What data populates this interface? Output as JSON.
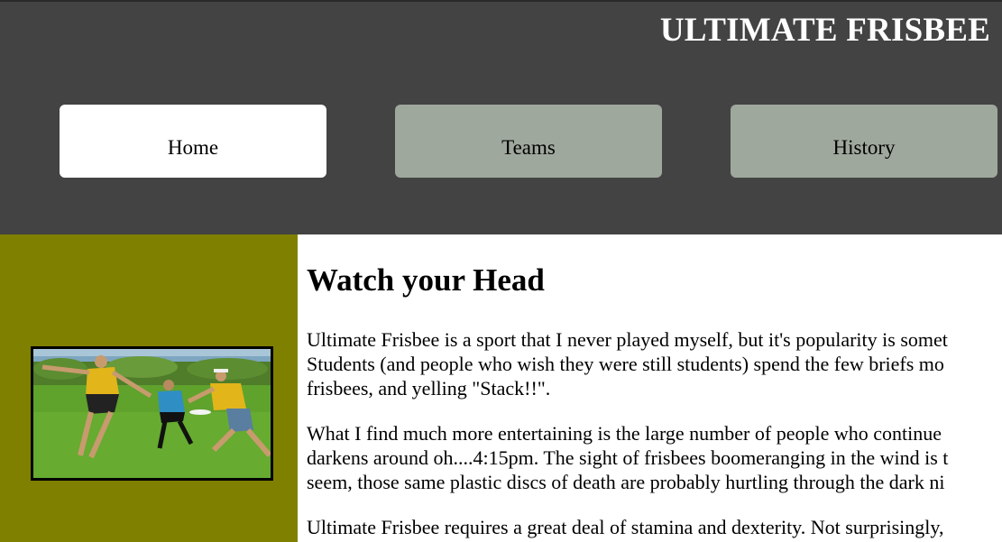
{
  "header": {
    "site_title": "ULTIMATE FRISBEE"
  },
  "nav": {
    "items": [
      {
        "label": "Home",
        "active": true
      },
      {
        "label": "Teams",
        "active": false
      },
      {
        "label": "History",
        "active": false
      }
    ]
  },
  "sidebar": {
    "image_alt": "Ultimate frisbee players on a field"
  },
  "main": {
    "heading": "Watch your Head",
    "paragraphs": [
      {
        "lines": [
          "Ultimate Frisbee is a sport that I never played myself, but it's popularity is somet",
          "Students (and people who wish they were still students) spend the few briefs mo",
          "frisbees, and yelling \"Stack!!\"."
        ]
      },
      {
        "lines": [
          "What I find much more entertaining is the large number of people who continue",
          "darkens around oh....4:15pm. The sight of frisbees boomeranging in the wind is t",
          "seem, those same plastic discs of death are probably hurtling through the dark ni"
        ]
      },
      {
        "lines": [
          "Ultimate Frisbee requires a great deal of stamina and dexterity. Not surprisingly,"
        ]
      }
    ]
  },
  "colors": {
    "header_bg": "#434343",
    "nav_active": "#ffffff",
    "nav_inactive": "#9fa89c",
    "sidebar_bg": "#808000",
    "title_text": "#ffffff"
  }
}
